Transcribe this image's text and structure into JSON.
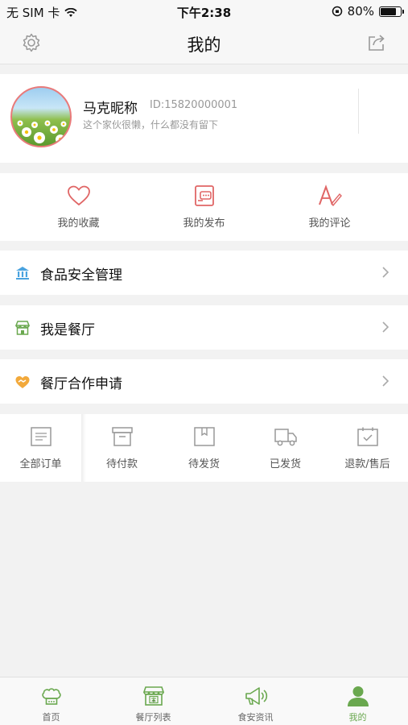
{
  "status_bar": {
    "carrier": "无 SIM 卡",
    "time": "下午2:38",
    "battery_percent": "80%",
    "battery_level": 0.8
  },
  "nav": {
    "title": "我的"
  },
  "profile": {
    "nickname": "马克昵称",
    "user_id": "ID:15820000001",
    "bio": "这个家伙很懒，什么都没有留下"
  },
  "quick_actions": [
    {
      "label": "我的收藏",
      "icon": "heart-icon"
    },
    {
      "label": "我的发布",
      "icon": "publish-icon"
    },
    {
      "label": "我的评论",
      "icon": "comment-pen-icon"
    }
  ],
  "menu": [
    {
      "label": "食品安全管理",
      "icon": "bank-icon"
    },
    {
      "label": "我是餐厅",
      "icon": "shop-icon"
    },
    {
      "label": "餐厅合作申请",
      "icon": "handshake-icon"
    }
  ],
  "orders": [
    {
      "label": "全部订单",
      "icon": "order-list-icon"
    },
    {
      "label": "待付款",
      "icon": "wallet-box-icon"
    },
    {
      "label": "待发货",
      "icon": "package-icon"
    },
    {
      "label": "已发货",
      "icon": "truck-icon"
    },
    {
      "label": "退款/售后",
      "icon": "calendar-check-icon"
    }
  ],
  "tabs": [
    {
      "label": "首页",
      "icon": "chef-hat-icon"
    },
    {
      "label": "餐厅列表",
      "icon": "storefront-icon"
    },
    {
      "label": "食安资讯",
      "icon": "megaphone-icon"
    },
    {
      "label": "我的",
      "icon": "user-icon",
      "active": true
    }
  ],
  "colors": {
    "accent_green": "#6aa84f",
    "icon_red": "#e06666",
    "icon_blue": "#4aa3df",
    "icon_orange": "#f2a93b"
  }
}
